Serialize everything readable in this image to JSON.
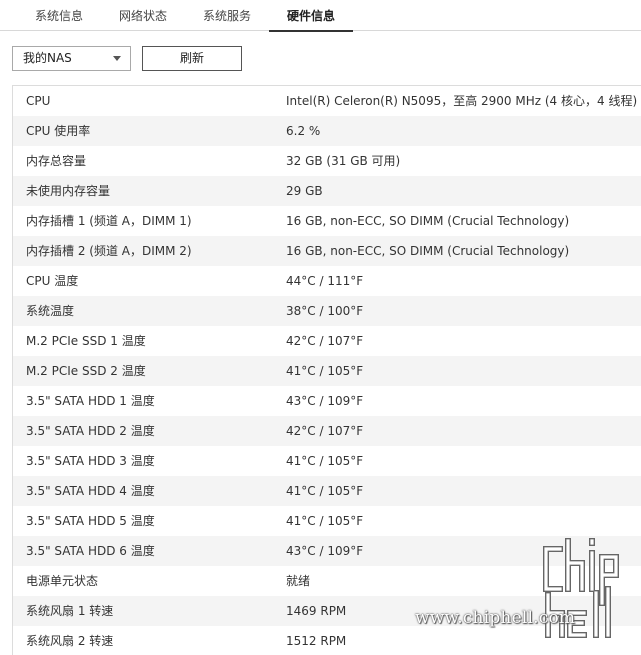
{
  "tabs": [
    {
      "label": "系统信息",
      "active": false
    },
    {
      "label": "网络状态",
      "active": false
    },
    {
      "label": "系统服务",
      "active": false
    },
    {
      "label": "硬件信息",
      "active": true
    }
  ],
  "toolbar": {
    "device_select": "我的NAS",
    "refresh_label": "刷新"
  },
  "hardware": [
    {
      "label": "CPU",
      "value": "Intel(R) Celeron(R) N5095，至高 2900 MHz (4 核心，4 线程)"
    },
    {
      "label": "CPU 使用率",
      "value": "6.2 %"
    },
    {
      "label": "内存总容量",
      "value": "32 GB (31 GB 可用)"
    },
    {
      "label": "未使用内存容量",
      "value": "29 GB"
    },
    {
      "label": "内存插槽 1 (频道 A，DIMM 1)",
      "value": "16 GB, non-ECC, SO DIMM (Crucial Technology)"
    },
    {
      "label": "内存插槽 2 (频道 A，DIMM 2)",
      "value": "16 GB, non-ECC, SO DIMM (Crucial Technology)"
    },
    {
      "label": "CPU 温度",
      "value": "44°C / 111°F"
    },
    {
      "label": "系统温度",
      "value": "38°C / 100°F"
    },
    {
      "label": "M.2 PCIe SSD 1 温度",
      "value": "42°C / 107°F"
    },
    {
      "label": "M.2 PCIe SSD 2 温度",
      "value": "41°C / 105°F"
    },
    {
      "label": "3.5\" SATA HDD 1 温度",
      "value": "43°C / 109°F"
    },
    {
      "label": "3.5\" SATA HDD 2 温度",
      "value": "42°C / 107°F"
    },
    {
      "label": "3.5\" SATA HDD 3 温度",
      "value": "41°C / 105°F"
    },
    {
      "label": "3.5\" SATA HDD 4 温度",
      "value": "41°C / 105°F"
    },
    {
      "label": "3.5\" SATA HDD 5 温度",
      "value": "41°C / 105°F"
    },
    {
      "label": "3.5\" SATA HDD 6 温度",
      "value": "43°C / 109°F"
    },
    {
      "label": "电源单元状态",
      "value": "就绪"
    },
    {
      "label": "系统风扇 1 转速",
      "value": "1469 RPM"
    },
    {
      "label": "系统风扇 2 转速",
      "value": "1512 RPM"
    }
  ],
  "watermark": {
    "logo_text": "chiphell",
    "url_text": "www.chiphell.com"
  }
}
